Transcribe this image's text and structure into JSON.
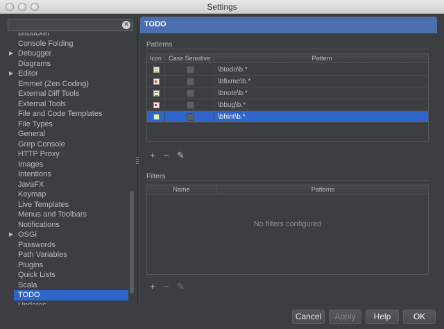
{
  "window": {
    "title": "Settings"
  },
  "sidebar": {
    "search": {
      "value": "",
      "placeholder": ""
    },
    "items": [
      {
        "label": "Bitbucket",
        "arrow": false
      },
      {
        "label": "Console Folding",
        "arrow": false
      },
      {
        "label": "Debugger",
        "arrow": true
      },
      {
        "label": "Diagrams",
        "arrow": false
      },
      {
        "label": "Editor",
        "arrow": true
      },
      {
        "label": "Emmet (Zen Coding)",
        "arrow": false
      },
      {
        "label": "External Diff Tools",
        "arrow": false
      },
      {
        "label": "External Tools",
        "arrow": false
      },
      {
        "label": "File and Code Templates",
        "arrow": false
      },
      {
        "label": "File Types",
        "arrow": false
      },
      {
        "label": "General",
        "arrow": false
      },
      {
        "label": "Grep Console",
        "arrow": false
      },
      {
        "label": "HTTP Proxy",
        "arrow": false
      },
      {
        "label": "Images",
        "arrow": false
      },
      {
        "label": "Intentions",
        "arrow": false
      },
      {
        "label": "JavaFX",
        "arrow": false
      },
      {
        "label": "Keymap",
        "arrow": false
      },
      {
        "label": "Live Templates",
        "arrow": false
      },
      {
        "label": "Menus and Toolbars",
        "arrow": false
      },
      {
        "label": "Notifications",
        "arrow": false
      },
      {
        "label": "OSGi",
        "arrow": true
      },
      {
        "label": "Passwords",
        "arrow": false
      },
      {
        "label": "Path Variables",
        "arrow": false
      },
      {
        "label": "Plugins",
        "arrow": false
      },
      {
        "label": "Quick Lists",
        "arrow": false
      },
      {
        "label": "Scala",
        "arrow": false
      },
      {
        "label": "TODO",
        "arrow": false,
        "selected": true
      },
      {
        "label": "Updates",
        "arrow": false
      }
    ]
  },
  "panel": {
    "title": "TODO",
    "patterns": {
      "label": "Patterns",
      "columns": [
        "Icon",
        "Case Sensitive",
        "Pattern"
      ],
      "rows": [
        {
          "icon": "todo-icon",
          "pattern": "\\btodo\\b.*",
          "case_sensitive": false
        },
        {
          "icon": "fixme-icon",
          "pattern": "\\bfixme\\b.*",
          "case_sensitive": false
        },
        {
          "icon": "todo-icon",
          "pattern": "\\bnote\\b.*",
          "case_sensitive": false
        },
        {
          "icon": "fixme-icon",
          "pattern": "\\bbug\\b.*",
          "case_sensitive": false
        },
        {
          "icon": "hint-icon",
          "pattern": "\\bhint\\b.*",
          "case_sensitive": false,
          "selected": true
        }
      ],
      "toolbar": {
        "add": "+",
        "remove": "−",
        "edit": "✎"
      }
    },
    "filters": {
      "label": "Filters",
      "columns": [
        "Name",
        "Patterns"
      ],
      "empty_text": "No filters configured",
      "toolbar": {
        "add": "+",
        "remove": "−",
        "edit": "✎"
      }
    }
  },
  "buttons": {
    "cancel": "Cancel",
    "apply": "Apply",
    "help": "Help",
    "ok": "OK"
  },
  "colors": {
    "selection": "#2f65ca",
    "header": "#4b6eaf",
    "background": "#3c3f41"
  }
}
